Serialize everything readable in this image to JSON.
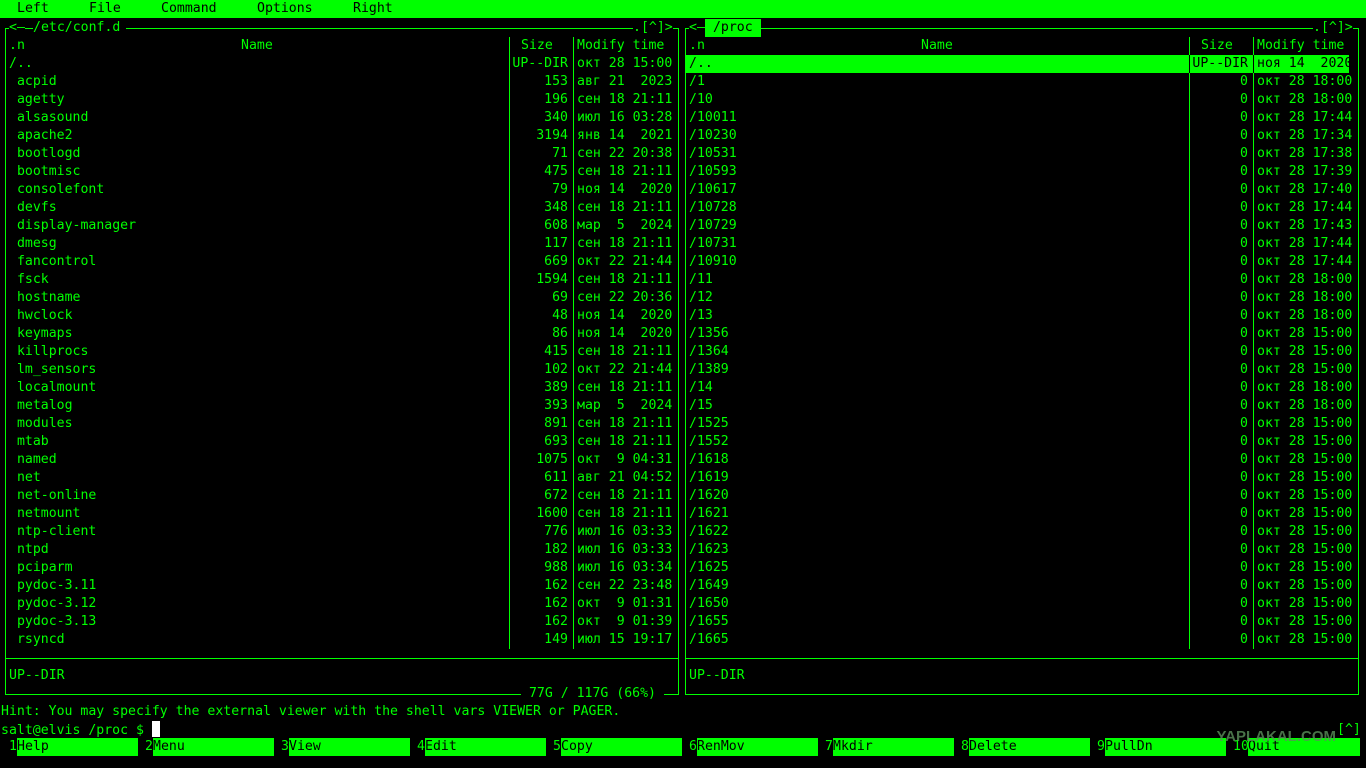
{
  "menu": [
    "Left",
    "File",
    "Command",
    "Options",
    "Right"
  ],
  "left_panel": {
    "title": "/etc/conf.d",
    "corner": ".[^]>",
    "corner_left": "<—",
    "headers": {
      "name_sort": ".n",
      "name": "Name",
      "size": "Size",
      "mtime": "Modify time"
    },
    "rows": [
      [
        "/..",
        "UP--DIR",
        "окт 28 15:00"
      ],
      [
        " acpid",
        "153",
        "авг 21  2023"
      ],
      [
        " agetty",
        "196",
        "сен 18 21:11"
      ],
      [
        " alsasound",
        "340",
        "июл 16 03:28"
      ],
      [
        " apache2",
        "3194",
        "янв 14  2021"
      ],
      [
        " bootlogd",
        "71",
        "сен 22 20:38"
      ],
      [
        " bootmisc",
        "475",
        "сен 18 21:11"
      ],
      [
        " consolefont",
        "79",
        "ноя 14  2020"
      ],
      [
        " devfs",
        "348",
        "сен 18 21:11"
      ],
      [
        " display-manager",
        "608",
        "мар  5  2024"
      ],
      [
        " dmesg",
        "117",
        "сен 18 21:11"
      ],
      [
        " fancontrol",
        "669",
        "окт 22 21:44"
      ],
      [
        " fsck",
        "1594",
        "сен 18 21:11"
      ],
      [
        " hostname",
        "69",
        "сен 22 20:36"
      ],
      [
        " hwclock",
        "48",
        "ноя 14  2020"
      ],
      [
        " keymaps",
        "86",
        "ноя 14  2020"
      ],
      [
        " killprocs",
        "415",
        "сен 18 21:11"
      ],
      [
        " lm_sensors",
        "102",
        "окт 22 21:44"
      ],
      [
        " localmount",
        "389",
        "сен 18 21:11"
      ],
      [
        " metalog",
        "393",
        "мар  5  2024"
      ],
      [
        " modules",
        "891",
        "сен 18 21:11"
      ],
      [
        " mtab",
        "693",
        "сен 18 21:11"
      ],
      [
        " named",
        "1075",
        "окт  9 04:31"
      ],
      [
        " net",
        "611",
        "авг 21 04:52"
      ],
      [
        " net-online",
        "672",
        "сен 18 21:11"
      ],
      [
        " netmount",
        "1600",
        "сен 18 21:11"
      ],
      [
        " ntp-client",
        "776",
        "июл 16 03:33"
      ],
      [
        " ntpd",
        "182",
        "июл 16 03:33"
      ],
      [
        " pciparm",
        "988",
        "июл 16 03:34"
      ],
      [
        " pydoc-3.11",
        "162",
        "сен 22 23:48"
      ],
      [
        " pydoc-3.12",
        "162",
        "окт  9 01:31"
      ],
      [
        " pydoc-3.13",
        "162",
        "окт  9 01:39"
      ],
      [
        " rsyncd",
        "149",
        "июл 15 19:17"
      ]
    ],
    "status": "UP--DIR",
    "disk": " 77G / 117G (66%) "
  },
  "right_panel": {
    "title": " /proc ",
    "corner": ".[^]>",
    "corner_left": "<—",
    "headers": {
      "name_sort": ".n",
      "name": "Name",
      "size": "Size",
      "mtime": "Modify time"
    },
    "rows": [
      [
        "/..",
        "UP--DIR",
        "ноя 14  2020"
      ],
      [
        "/1",
        "0",
        "окт 28 18:00"
      ],
      [
        "/10",
        "0",
        "окт 28 18:00"
      ],
      [
        "/10011",
        "0",
        "окт 28 17:44"
      ],
      [
        "/10230",
        "0",
        "окт 28 17:34"
      ],
      [
        "/10531",
        "0",
        "окт 28 17:38"
      ],
      [
        "/10593",
        "0",
        "окт 28 17:39"
      ],
      [
        "/10617",
        "0",
        "окт 28 17:40"
      ],
      [
        "/10728",
        "0",
        "окт 28 17:44"
      ],
      [
        "/10729",
        "0",
        "окт 28 17:43"
      ],
      [
        "/10731",
        "0",
        "окт 28 17:44"
      ],
      [
        "/10910",
        "0",
        "окт 28 17:44"
      ],
      [
        "/11",
        "0",
        "окт 28 18:00"
      ],
      [
        "/12",
        "0",
        "окт 28 18:00"
      ],
      [
        "/13",
        "0",
        "окт 28 18:00"
      ],
      [
        "/1356",
        "0",
        "окт 28 15:00"
      ],
      [
        "/1364",
        "0",
        "окт 28 15:00"
      ],
      [
        "/1389",
        "0",
        "окт 28 15:00"
      ],
      [
        "/14",
        "0",
        "окт 28 18:00"
      ],
      [
        "/15",
        "0",
        "окт 28 18:00"
      ],
      [
        "/1525",
        "0",
        "окт 28 15:00"
      ],
      [
        "/1552",
        "0",
        "окт 28 15:00"
      ],
      [
        "/1618",
        "0",
        "окт 28 15:00"
      ],
      [
        "/1619",
        "0",
        "окт 28 15:00"
      ],
      [
        "/1620",
        "0",
        "окт 28 15:00"
      ],
      [
        "/1621",
        "0",
        "окт 28 15:00"
      ],
      [
        "/1622",
        "0",
        "окт 28 15:00"
      ],
      [
        "/1623",
        "0",
        "окт 28 15:00"
      ],
      [
        "/1625",
        "0",
        "окт 28 15:00"
      ],
      [
        "/1649",
        "0",
        "окт 28 15:00"
      ],
      [
        "/1650",
        "0",
        "окт 28 15:00"
      ],
      [
        "/1655",
        "0",
        "окт 28 15:00"
      ],
      [
        "/1665",
        "0",
        "окт 28 15:00"
      ]
    ],
    "status": "UP--DIR"
  },
  "hint": "Hint: You may specify the external viewer with the shell vars VIEWER or PAGER.",
  "prompt": "salt@elvis /proc $ ",
  "prompt_corner": "[^]",
  "fkeys": [
    [
      "1",
      "Help"
    ],
    [
      "2",
      "Menu"
    ],
    [
      "3",
      "View"
    ],
    [
      "4",
      "Edit"
    ],
    [
      "5",
      "Copy"
    ],
    [
      "6",
      "RenMov"
    ],
    [
      "7",
      "Mkdir"
    ],
    [
      "8",
      "Delete"
    ],
    [
      "9",
      "PullDn"
    ],
    [
      "10",
      "Quit"
    ]
  ],
  "watermark": "YAPLAKAL.COM",
  "colors": {
    "fg": "#00ff00",
    "bg": "#000000"
  }
}
